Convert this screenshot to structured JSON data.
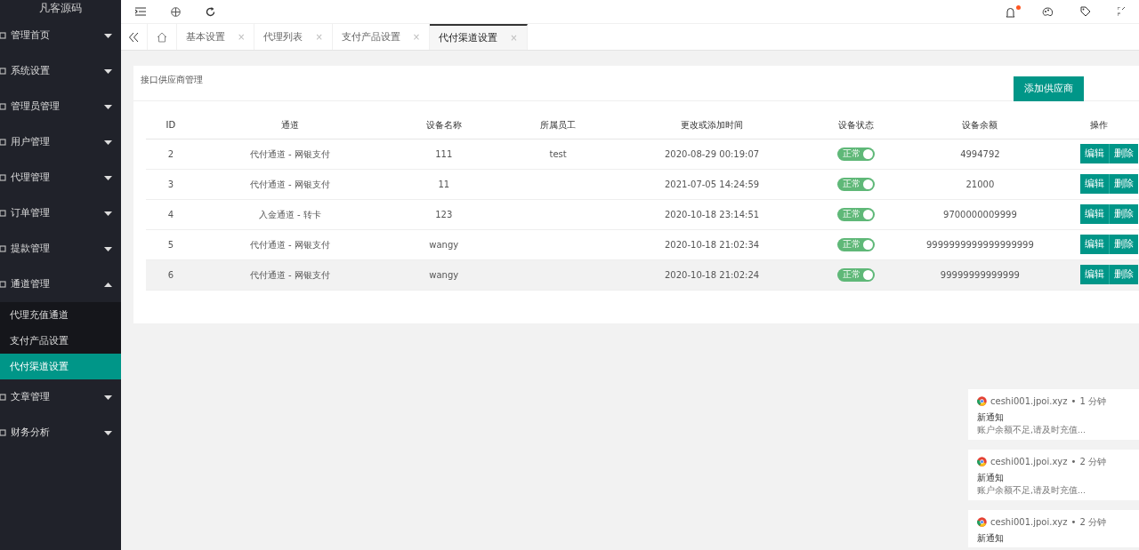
{
  "sidebar": {
    "title": "凡客源码",
    "items": [
      {
        "label": "管理首页",
        "expanded": false
      },
      {
        "label": "系统设置",
        "expanded": false
      },
      {
        "label": "管理员管理",
        "expanded": false
      },
      {
        "label": "用户管理",
        "expanded": false
      },
      {
        "label": "代理管理",
        "expanded": false
      },
      {
        "label": "订单管理",
        "expanded": false
      },
      {
        "label": "提款管理",
        "expanded": false
      },
      {
        "label": "通道管理",
        "expanded": true,
        "children": [
          {
            "label": "代理充值通道",
            "selected": false
          },
          {
            "label": "支付产品设置",
            "selected": false
          },
          {
            "label": "代付渠道设置",
            "selected": true
          }
        ]
      },
      {
        "label": "文章管理",
        "expanded": false
      },
      {
        "label": "财务分析",
        "expanded": false
      }
    ]
  },
  "tabs": [
    {
      "label": "基本设置",
      "close": "×",
      "selected": false
    },
    {
      "label": "代理列表",
      "close": "×",
      "selected": false
    },
    {
      "label": "支付产品设置",
      "close": "×",
      "selected": false
    },
    {
      "label": "代付渠道设置",
      "close": "×",
      "selected": true
    }
  ],
  "panel": {
    "title": "接口供应商管理",
    "add_button": "添加供应商"
  },
  "table": {
    "columns": [
      "ID",
      "通道",
      "设备名称",
      "所属员工",
      "更改或添加时间",
      "设备状态",
      "设备余额",
      "操作"
    ],
    "rows": [
      {
        "id": "2",
        "channel": "代付通道 - 网银支付",
        "device": "111",
        "staff": "test",
        "time": "2020-08-29 00:19:07",
        "status": "正常",
        "on": true,
        "balance": "4994792",
        "highlighted": false,
        "actions": [
          "编辑",
          "删除"
        ]
      },
      {
        "id": "3",
        "channel": "代付通道 - 网银支付",
        "device": "11",
        "staff": "",
        "time": "2021-07-05 14:24:59",
        "status": "正常",
        "on": true,
        "balance": "21000",
        "highlighted": false,
        "actions": [
          "编辑",
          "删除"
        ]
      },
      {
        "id": "4",
        "channel": "入金通道 - 转卡",
        "device": "123",
        "staff": "",
        "time": "2020-10-18 23:14:51",
        "status": "正常",
        "on": true,
        "balance": "9700000009999",
        "highlighted": false,
        "actions": [
          "编辑",
          "删除"
        ]
      },
      {
        "id": "5",
        "channel": "代付通道 - 网银支付",
        "device": "wangy",
        "staff": "",
        "time": "2020-10-18 21:02:34",
        "status": "正常",
        "on": true,
        "balance": "9999999999999999999",
        "highlighted": false,
        "actions": [
          "编辑",
          "删除"
        ]
      },
      {
        "id": "6",
        "channel": "代付通道 - 网银支付",
        "device": "wangy",
        "staff": "",
        "time": "2020-10-18 21:02:24",
        "status": "正常",
        "on": true,
        "balance": "99999999999999",
        "highlighted": true,
        "actions": [
          "编辑",
          "删除"
        ]
      }
    ]
  },
  "notifications": [
    {
      "site": "ceshi001.jpoi.xyz",
      "separator": "•",
      "time": "1 分钟",
      "title": "新通知",
      "body": "账户余额不足,请及时充值..."
    },
    {
      "site": "ceshi001.jpoi.xyz",
      "separator": "•",
      "time": "2 分钟",
      "title": "新通知",
      "body": "账户余额不足,请及时充值..."
    },
    {
      "site": "ceshi001.jpoi.xyz",
      "separator": "•",
      "time": "2 分钟",
      "title": "新通知"
    }
  ]
}
